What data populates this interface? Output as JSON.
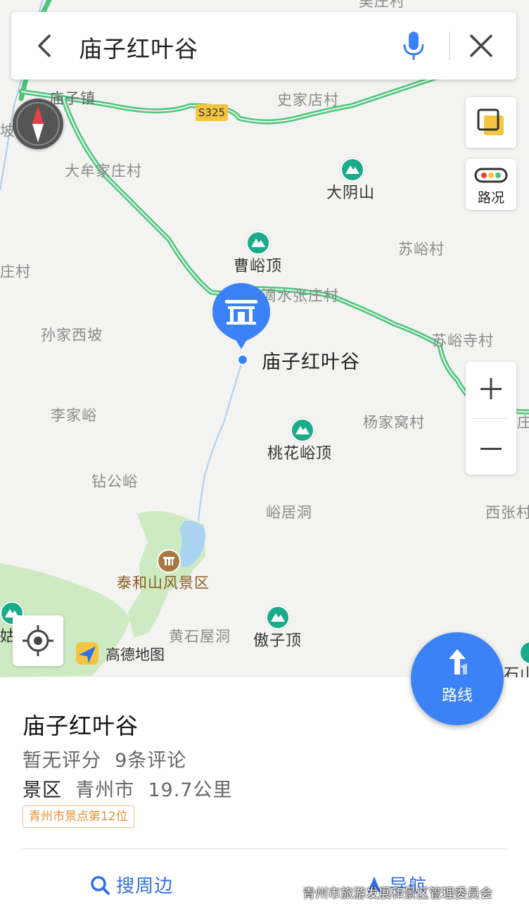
{
  "search": {
    "query": "庙子红叶谷"
  },
  "map": {
    "road_badge": "S325",
    "labels": {
      "top_cut": "吴庄村",
      "miaozizhen": "庙子镇",
      "shijiadian": "史家店村",
      "po": "坡",
      "danian": "大牟家庄村",
      "dayinshan": "大阴山",
      "zhuangcun": "庄村",
      "caoyuding": "曹峪顶",
      "suyucun": "苏峪村",
      "dishui": "滴水张庄村",
      "sunjia": "孙家西坡",
      "suyusi": "苏峪寺村",
      "lijiayu": "李家峪",
      "yangjiawo": "杨家窝村",
      "zhuang_right": "庄",
      "taohua": "桃花峪顶",
      "zuangong": "钻公峪",
      "yujudong": "峪居洞",
      "xizhang": "西张村",
      "taihe": "泰和山风景区",
      "gu": "姑",
      "huangshi": "黄石屋洞",
      "aoziding": "傲子顶",
      "shi": "石山"
    },
    "pin_label": "庙子红叶谷",
    "traffic_label": "路况",
    "logo_text": "高德地图",
    "route_label": "路线"
  },
  "colors": {
    "accent": "#3b82f6",
    "road": "#4fc47d",
    "peak": "#1aab8a",
    "tag": "#e8903a"
  },
  "poi": {
    "name": "庙子红叶谷",
    "rating": "暂无评分",
    "reviews": "9条评论",
    "category": "景区",
    "city": "青州市",
    "distance": "19.7公里",
    "rank_tag": "青州市景点第12位"
  },
  "actions": {
    "nearby": "搜周边",
    "navigate": "导航"
  },
  "watermark": "青州市旅游发展和景区管理委员会"
}
